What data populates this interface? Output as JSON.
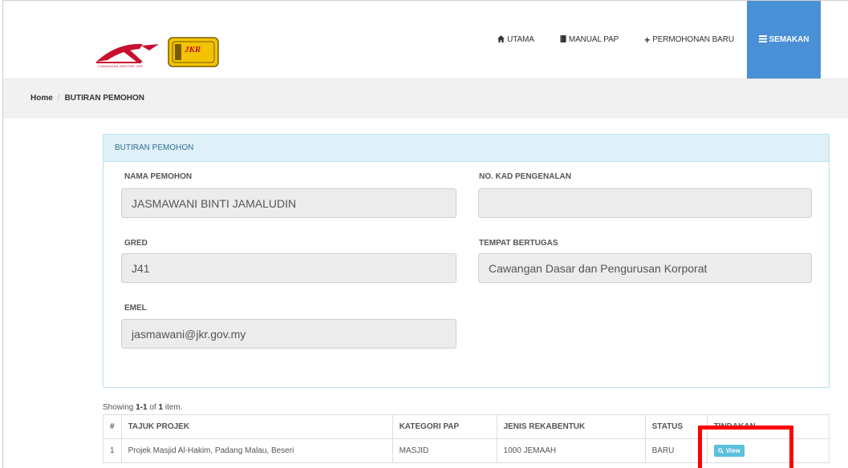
{
  "navbar": {
    "logo_text": "CAWANGAN ARKITEK JKR",
    "jkr_text": "JKR",
    "items": [
      {
        "label": "UTAMA",
        "icon": "home-icon"
      },
      {
        "label": "MANUAL PAP",
        "icon": "book-icon"
      },
      {
        "label": "PERMOHONAN BARU",
        "icon": "plus-icon"
      },
      {
        "label": "SEMAKAN",
        "icon": "list-icon"
      }
    ],
    "active_color": "#4a90d6"
  },
  "breadcrumb": {
    "home": "Home",
    "separator": "/",
    "current": "BUTIRAN PEMOHON"
  },
  "panel": {
    "title": "BUTIRAN PEMOHON",
    "fields": {
      "nama_label": "NAMA PEMOHON",
      "nama_value": "JASMAWANI BINTI JAMALUDIN",
      "kad_label": "NO. KAD PENGENALAN",
      "kad_value": "",
      "gred_label": "GRED",
      "gred_value": "J41",
      "tempat_label": "TEMPAT BERTUGAS",
      "tempat_value": "Cawangan Dasar dan Pengurusan Korporat",
      "emel_label": "EMEL",
      "emel_value": "jasmawani@jkr.gov.my"
    }
  },
  "table": {
    "summary_prefix": "Showing ",
    "summary_range": "1-1",
    "summary_mid": " of ",
    "summary_total": "1",
    "summary_suffix": " item.",
    "headers": [
      "#",
      "TAJUK PROJEK",
      "KATEGORI PAP",
      "JENIS REKABENTUK",
      "STATUS",
      "TINDAKAN"
    ],
    "rows": [
      {
        "num": "1",
        "tajuk": "Projek Masjid Al-Hakim, Padang Malau, Beseri",
        "kategori": "MASJID",
        "jenis": "1000 JEMAAH",
        "status": "BARU",
        "action": "View"
      }
    ]
  },
  "colors": {
    "highlight": "#ff0000",
    "view_button": "#5bc0de"
  }
}
